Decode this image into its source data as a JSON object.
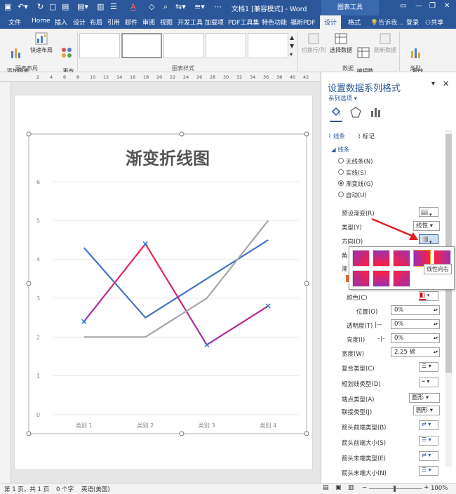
{
  "titlebar": {
    "doc_title": "文档1 [兼容模式] - Word",
    "context_tab": "图表工具",
    "login": "登录",
    "share": "共享",
    "tell_me": "告诉我..."
  },
  "tabs": [
    "文件",
    "Home",
    "插入",
    "设计",
    "布局",
    "引用",
    "邮件",
    "审阅",
    "视图",
    "开发工具",
    "加载项",
    "PDF工具集",
    "特色功能",
    "福昕PDF",
    "设计",
    "格式"
  ],
  "ribbon": {
    "add_element": "添加图表\n元素",
    "quick_layout": "快速布局",
    "change_colors": "更改\n颜色",
    "switch_rowcol": "切换行/列",
    "select_data": "选择数据",
    "edit_data": "编辑数\n据",
    "refresh_data": "刷新数据",
    "change_type": "更改\n图表类型",
    "group_layout": "图表布局",
    "group_styles": "图表样式",
    "group_data": "数据",
    "group_type": "类型"
  },
  "ruler_ticks": [
    "2",
    "4",
    "6",
    "8",
    "10",
    "12",
    "14",
    "16",
    "18",
    "20",
    "22",
    "24",
    "26",
    "28",
    "30",
    "32",
    "34",
    "36",
    "38",
    "40",
    "42"
  ],
  "chart_data": {
    "type": "line",
    "title": "渐变折线图",
    "categories": [
      "类别 1",
      "类别 2",
      "类别 3",
      "类别 4"
    ],
    "ylim": [
      0,
      6
    ],
    "yticks": [
      "0",
      "1",
      "2",
      "3",
      "4",
      "5",
      "6"
    ],
    "series": [
      {
        "values": [
          4.3,
          2.5,
          3.5,
          4.5
        ],
        "color": "#4472c4"
      },
      {
        "values": [
          2.4,
          4.4,
          1.8,
          2.8
        ],
        "color": "gradient"
      },
      {
        "values": [
          2.0,
          2.0,
          3.0,
          5.0
        ],
        "color": "#a5a5a5"
      }
    ]
  },
  "pane": {
    "title": "设置数据系列格式",
    "subtitle": "系列选项",
    "tab_line": "线条",
    "tab_marker": "标记",
    "section": "线条",
    "opt_none": "无线条(N)",
    "opt_solid": "实线(S)",
    "opt_gradient": "渐变线(G)",
    "opt_auto": "自动(U)",
    "preset": "预设渐变(R)",
    "type": "类型(Y)",
    "type_val": "线性",
    "direction": "方向(D)",
    "angle": "角",
    "stops": "渐",
    "color": "颜色(C)",
    "position": "位置(O)",
    "position_val": "0%",
    "transparency": "透明度(T)",
    "transparency_val": "0%",
    "brightness": "亮度(I)",
    "brightness_val": "0%",
    "width": "宽度(W)",
    "width_val": "2.25 磅",
    "compound": "复合类型(C)",
    "dash": "短划线类型(D)",
    "cap": "端点类型(A)",
    "cap_val": "圆形",
    "join": "联接类型(J)",
    "join_val": "圆形",
    "arrow_begin_type": "箭头前端类型(B)",
    "arrow_begin_size": "箭头前端大小(S)",
    "arrow_end_type": "箭头末端类型(E)",
    "arrow_end_size": "箭头末端大小(N)"
  },
  "popup": {
    "tooltip": "线性向右"
  },
  "status": {
    "page": "第 1 页，共 1 页",
    "words": "0 个字",
    "lang": "英语(美国)",
    "zoom": "100%"
  },
  "colors": {
    "accent": "#2b579a",
    "red_arrow": "#e02020"
  }
}
